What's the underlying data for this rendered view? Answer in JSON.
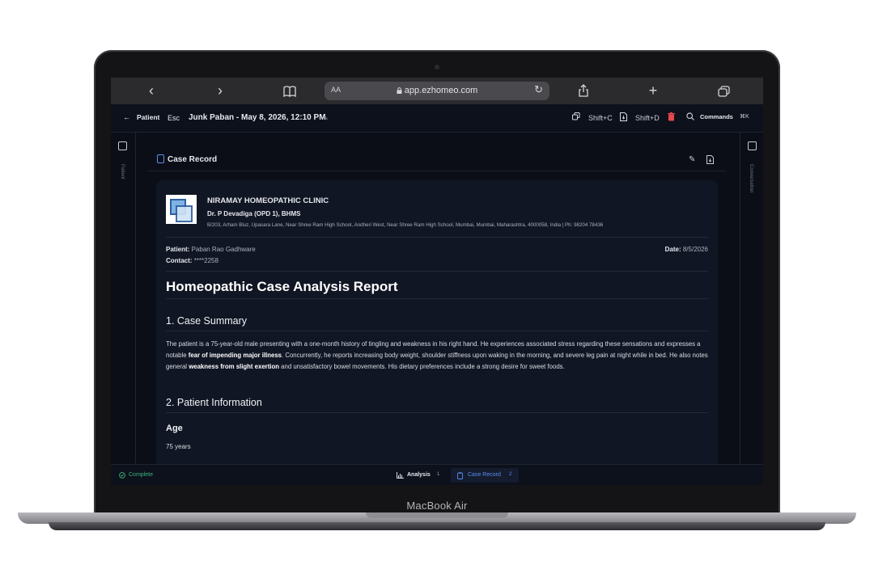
{
  "device": {
    "brand": "MacBook Air"
  },
  "browser": {
    "back_icon": "‹",
    "forward_icon": "›",
    "text_size": "AA",
    "url": "app.ezhomeo.com",
    "reload_icon": "↻",
    "plus_icon": "+"
  },
  "appbar": {
    "back_label": "Patient",
    "back_kbd": "Esc",
    "title": "Junk Paban - May 8, 2026, 12:10 PM",
    "copy_kbd": "Shift+C",
    "export_kbd": "Shift+D",
    "commands_label": "Commands",
    "commands_kbd": "⌘K"
  },
  "rails": {
    "left_label": "Patient",
    "right_label": "Conversation"
  },
  "case_record": {
    "header_label": "Case Record"
  },
  "document": {
    "clinic_name": "NIRAMAY HOMEOPATHIC CLINIC",
    "doctor": "Dr. P Devadiga (OPD 1), BHMS",
    "address": "B/203, Arham Bluz, Upasara Lane, Near Shree Ram High School, Andheri West, Near Shree Ram High School, Mumbai, Mumbai, Maharashtra, 4000058, India | Ph: 98204 78436",
    "patient_label": "Patient:",
    "patient_value": "Paban Rao Gadhware",
    "contact_label": "Contact:",
    "contact_value": "****2258",
    "date_label": "Date:",
    "date_value": "8/5/2026",
    "report_title": "Homeopathic Case Analysis Report",
    "section1_title": "1. Case Summary",
    "summary": {
      "p1": "The patient is a 75-year-old male presenting with a one-month history of tingling and weakness in his right hand. He experiences associated stress regarding these sensations and expresses a notable ",
      "b1": "fear of impending major illness",
      "p2": ". Concurrently, he reports increasing body weight, shoulder stiffness upon waking in the morning, and severe leg pain at night while in bed. He also notes general ",
      "b2": "weakness from slight exertion",
      "p3": " and unsatisfactory bowel movements. His dietary preferences include a strong desire for sweet foods."
    },
    "section2_title": "2. Patient Information",
    "age_heading": "Age",
    "age_value": "75 years"
  },
  "statusbar": {
    "status": "Complete",
    "tab_analysis": "Analysis",
    "tab_analysis_count": "1",
    "tab_case_record": "Case Record",
    "tab_case_record_count": "2"
  },
  "colors": {
    "accent": "#5b8def",
    "status_green": "#3fb27f",
    "danger": "#e5484d"
  }
}
